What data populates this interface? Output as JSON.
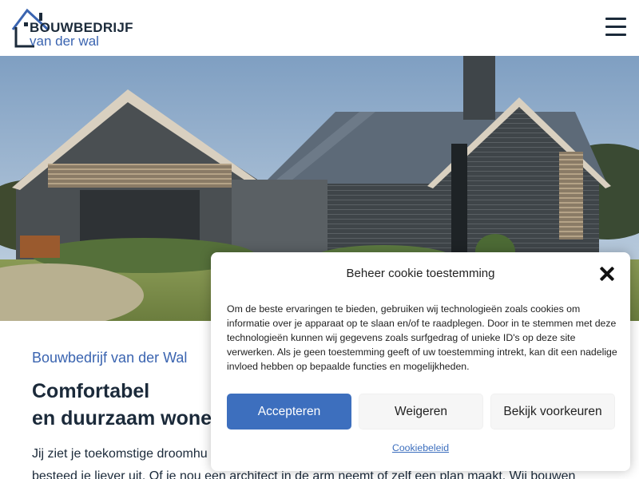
{
  "header": {
    "logo": {
      "line1": "BOUWBEDRIJF",
      "line2": "van der wal"
    },
    "menu_icon": "hamburger-menu-icon"
  },
  "hero": {
    "image": "modern barn-style house with dark brick, metal roof and timber slats"
  },
  "main": {
    "eyebrow": "Bouwbedrijf van der Wal",
    "headline_line1": "Comfortabel",
    "headline_line2": "en duurzaam wone",
    "body_line1": "Jij ziet je toekomstige droomhu",
    "body_line2": "besteed je liever uit. Of je nou een architect in de arm neemt of zelf een plan maakt. Wij bouwen"
  },
  "cookie_modal": {
    "title": "Beheer cookie toestemming",
    "close_icon": "close-icon",
    "text": "Om de beste ervaringen te bieden, gebruiken wij technologieën zoals cookies om informatie over je apparaat op te slaan en/of te raadplegen. Door in te stemmen met deze technologieën kunnen wij gegevens zoals surfgedrag of unieke ID's op deze site verwerken. Als je geen toestemming geeft of uw toestemming intrekt, kan dit een nadelige invloed hebben op bepaalde functies en mogelijkheden.",
    "accept_label": "Accepteren",
    "deny_label": "Weigeren",
    "prefs_label": "Bekijk voorkeuren",
    "policy_link": "Cookiebeleid"
  },
  "colors": {
    "accent": "#3d6fbe",
    "navy": "#1b2a3a",
    "brand_blue": "#3a64b0"
  }
}
